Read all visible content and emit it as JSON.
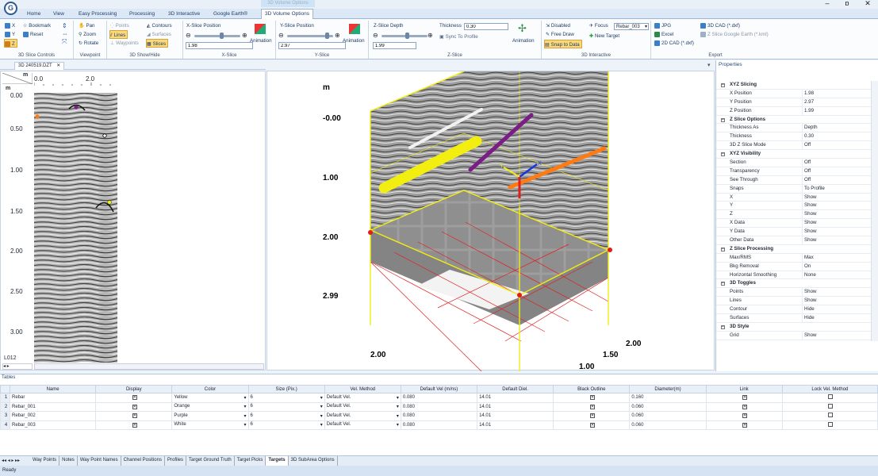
{
  "window": {
    "context_title": "3D Volume Options",
    "min": "–",
    "max": "ɒ",
    "close": "✕"
  },
  "tabs": [
    "Home",
    "View",
    "Easy Processing",
    "Processing",
    "3D Interactive",
    "Google Earth®",
    "3D Volume Options"
  ],
  "ribbon": {
    "slice_controls": {
      "items": [
        "X",
        "Y",
        "Z"
      ],
      "bookmark": "Bookmark",
      "reset": "Reset",
      "label": "3D Slice Controls",
      "selected": "Z"
    },
    "viewpoint": {
      "pan": "Pan",
      "zoom": "Zoom",
      "rotate": "Rotate",
      "label": "Viewpoint"
    },
    "show_hide": {
      "points": "Points",
      "lines": "Lines",
      "waypoints": "Waypoints",
      "contours": "Contours",
      "surfaces": "Surfaces",
      "slices": "Slices",
      "label": "3D Show/Hide"
    },
    "x_slice": {
      "title": "X-Slice Position",
      "value": "1.98",
      "animation": "Animation",
      "label": "X-Slice"
    },
    "y_slice": {
      "title": "Y-Slice Position",
      "value": "2.97",
      "animation": "Animation",
      "label": "Y-Slice"
    },
    "z_slice": {
      "title": "Z-Slice Depth",
      "value": "1.99",
      "thickness_label": "Thickness",
      "thickness": "0.30",
      "sync": "Sync To Profile",
      "animation": "Animation",
      "label": "Z-Slice"
    },
    "interactive": {
      "disabled": "Disabled",
      "free_draw": "Free Draw",
      "snap": "Snap to Data",
      "focus_label": "Focus",
      "focus_value": "Rebar_003",
      "new_target": "New Target",
      "label": "3D Interactive"
    },
    "export": {
      "jpg": "JPG",
      "excel": "Excel",
      "cad2d": "2D CAD (*.dxf)",
      "cad3d": "3D CAD (*.dxf)",
      "z_slice_ge": "Z Slice Google Earth (*.kml)",
      "label": "Export"
    }
  },
  "document_tab": "3D 240519.DZT",
  "profile": {
    "units": "m",
    "x_ticks": [
      "0.0",
      "2.0"
    ],
    "y_ticks": [
      "0.00",
      "0.50",
      "1.00",
      "1.50",
      "2.00",
      "2.50",
      "3.00"
    ],
    "line_id": "L012"
  },
  "view3d": {
    "unit": "m",
    "depth_ticks": [
      "-0.00",
      "1.00",
      "2.00",
      "2.99"
    ],
    "x_ticks_left": [
      "2.00"
    ],
    "x_ticks_right": [
      "2.00",
      "1.50",
      "1.00"
    ],
    "axes": [
      "Y",
      "X"
    ],
    "targets": [
      {
        "name": "Rebar",
        "color": "#f2ee10"
      },
      {
        "name": "Rebar_001",
        "color": "#ff7a10"
      },
      {
        "name": "Rebar_002",
        "color": "#7a1e86"
      },
      {
        "name": "Rebar_003",
        "color": "#f2f2f2"
      }
    ]
  },
  "properties": {
    "title": "Properties",
    "rows": [
      {
        "cat": true,
        "k": "XYZ Slicing"
      },
      {
        "k": "X Position",
        "v": "1.98"
      },
      {
        "k": "Y Position",
        "v": "2.97"
      },
      {
        "k": "Z Position",
        "v": "1.99"
      },
      {
        "cat": true,
        "k": "Z Slice Options"
      },
      {
        "k": "Thickness As",
        "v": "Depth"
      },
      {
        "k": "Thickness",
        "v": "0.30"
      },
      {
        "k": "3D Z Slice Mode",
        "v": "Off"
      },
      {
        "cat": true,
        "k": "XYZ Visibility"
      },
      {
        "k": "Section",
        "v": "Off"
      },
      {
        "k": "Transparency",
        "v": "Off"
      },
      {
        "k": "See Through",
        "v": "Off"
      },
      {
        "k": "Snaps",
        "v": "To Profile"
      },
      {
        "k": "X",
        "v": "Show"
      },
      {
        "k": "Y",
        "v": "Show"
      },
      {
        "k": "Z",
        "v": "Show"
      },
      {
        "k": "X Data",
        "v": "Show"
      },
      {
        "k": "Y Data",
        "v": "Show"
      },
      {
        "k": "Other Data",
        "v": "Show"
      },
      {
        "cat": true,
        "k": "Z Slice Processing"
      },
      {
        "k": "Max/RMS",
        "v": "Max"
      },
      {
        "k": "Bkg Removal",
        "v": "On"
      },
      {
        "k": "Horizontal Smoothing",
        "v": "None"
      },
      {
        "cat": true,
        "k": "3D Toggles"
      },
      {
        "k": "Points",
        "v": "Show"
      },
      {
        "k": "Lines",
        "v": "Show"
      },
      {
        "k": "Contour",
        "v": "Hide"
      },
      {
        "k": "Surfaces",
        "v": "Hide"
      },
      {
        "cat": true,
        "k": "3D Style"
      },
      {
        "k": "Grid",
        "v": "Show"
      }
    ]
  },
  "tables": {
    "title": "Tables",
    "headers": [
      "Name",
      "Display",
      "Color",
      "Size (Pix.)",
      "Vel. Method",
      "Default Vel (m/ns)",
      "Default Diel.",
      "Black Outline",
      "Diameter(m)",
      "Link",
      "Lock Vel. Method"
    ],
    "rows": [
      {
        "num": "1",
        "name": "Rebar",
        "display": true,
        "color": "Yellow",
        "size": "6",
        "vel_method": "Default Vel.",
        "vel": "0.080",
        "diel": "14.01",
        "outline": true,
        "diameter": "0.160",
        "link": true,
        "lock": false
      },
      {
        "num": "2",
        "name": "Rebar_001",
        "display": true,
        "color": "Orange",
        "size": "6",
        "vel_method": "Default Vel.",
        "vel": "0.080",
        "diel": "14.01",
        "outline": true,
        "diameter": "0.060",
        "link": true,
        "lock": false
      },
      {
        "num": "3",
        "name": "Rebar_002",
        "display": true,
        "color": "Purple",
        "size": "6",
        "vel_method": "Default Vel.",
        "vel": "0.080",
        "diel": "14.01",
        "outline": true,
        "diameter": "0.060",
        "link": true,
        "lock": false
      },
      {
        "num": "4",
        "name": "Rebar_003",
        "display": true,
        "color": "White",
        "size": "6",
        "vel_method": "Default Vel.",
        "vel": "0.080",
        "diel": "14.01",
        "outline": true,
        "diameter": "0.060",
        "link": true,
        "lock": false
      }
    ]
  },
  "bottom_tabs": [
    "Way Points",
    "Notes",
    "Way Point Names",
    "Channel Positions",
    "Profiles",
    "Target Ground Truth",
    "Target Picks",
    "Targets",
    "3D SubArea Options"
  ],
  "active_bottom_tab": "Targets",
  "status": "Ready"
}
